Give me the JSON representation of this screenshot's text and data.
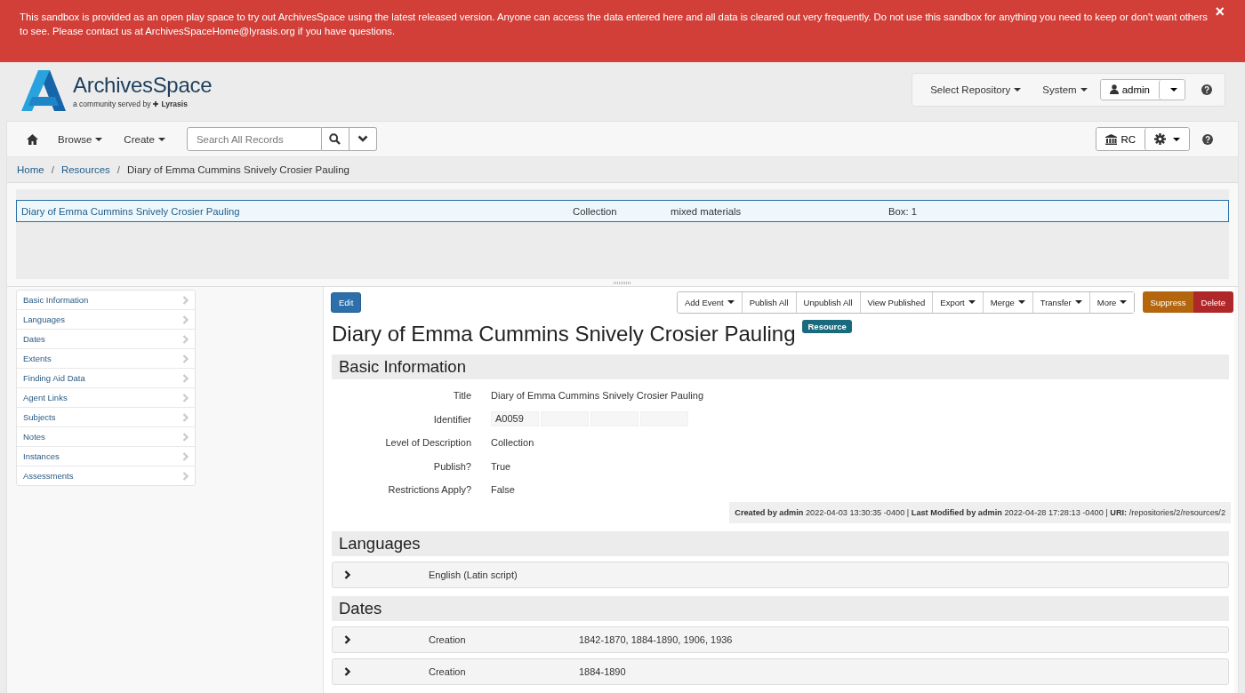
{
  "banner": {
    "text": "This sandbox is provided as an open play space to try out ArchivesSpace using the latest released version. Anyone can access the data entered here and all data is cleared out very frequently. Do not use this sandbox for anything you need to keep or don't want others to see. Please contact us at ArchivesSpaceHome@lyrasis.org if you have questions.",
    "close": "×"
  },
  "header": {
    "brand": "ArchivesSpace",
    "tagline": "a community served by",
    "partner": "Lyrasis",
    "menus": [
      "Select Repository",
      "System"
    ],
    "user": "admin"
  },
  "toolbar": {
    "menus": [
      "Browse",
      "Create"
    ],
    "search": {
      "placeholder": "Search All Records"
    },
    "repository": "RC"
  },
  "breadcrumb": [
    {
      "label": "Home",
      "separator": "/"
    },
    {
      "label": "Resources",
      "separator": "/"
    },
    {
      "label": "Diary of Emma Cummins Snively Crosier Pauling"
    }
  ],
  "tree": {
    "rows": [
      {
        "title": "Diary of Emma Cummins Snively Crosier Pauling",
        "level": "Collection",
        "type": "mixed materials",
        "container": "Box: 1",
        "selected": true
      }
    ]
  },
  "sidebar": {
    "items": [
      "Basic Information",
      "Languages",
      "Dates",
      "Extents",
      "Finding Aid Data",
      "Agent Links",
      "Subjects",
      "Notes",
      "Instances",
      "Assessments"
    ]
  },
  "actions": {
    "edit": "Edit",
    "buttons": [
      {
        "label": "Add Event",
        "menu": true
      },
      {
        "label": "Publish All",
        "menu": false
      },
      {
        "label": "Unpublish All",
        "menu": false
      },
      {
        "label": "View Published",
        "menu": false
      },
      {
        "label": "Export",
        "menu": true
      },
      {
        "label": "Merge",
        "menu": true
      },
      {
        "label": "Transfer",
        "menu": true
      },
      {
        "label": "More",
        "menu": true
      }
    ],
    "suppress": "Suppress",
    "delete": "Delete"
  },
  "record": {
    "title": "Diary of Emma Cummins Snively Crosier Pauling",
    "badge": "Resource"
  },
  "basic": {
    "heading": "Basic Information",
    "fields": [
      {
        "label": "Title",
        "value": "Diary of Emma Cummins Snively Crosier Pauling",
        "kind": "text"
      },
      {
        "label": "Identifier",
        "value": "A0059",
        "kind": "identifier"
      },
      {
        "label": "Level of Description",
        "value": "Collection",
        "kind": "text"
      },
      {
        "label": "Publish?",
        "value": "True",
        "kind": "text"
      },
      {
        "label": "Restrictions Apply?",
        "value": "False",
        "kind": "text"
      }
    ],
    "meta": "**Created by admin** 2022-04-03 13:30:35 -0400 | **Last Modified by admin** 2022-04-28 17:28:13 -0400 | **URI:** /repositories/2/resources/2"
  },
  "sections": [
    {
      "heading": "Languages",
      "rows": [
        {
          "cells": [
            "English (Latin script)"
          ]
        }
      ]
    },
    {
      "heading": "Dates",
      "rows": [
        {
          "cells": [
            "Creation",
            "1842-1870, 1884-1890, 1906, 1936"
          ]
        },
        {
          "cells": [
            "Creation",
            "1884-1890"
          ]
        }
      ]
    }
  ]
}
